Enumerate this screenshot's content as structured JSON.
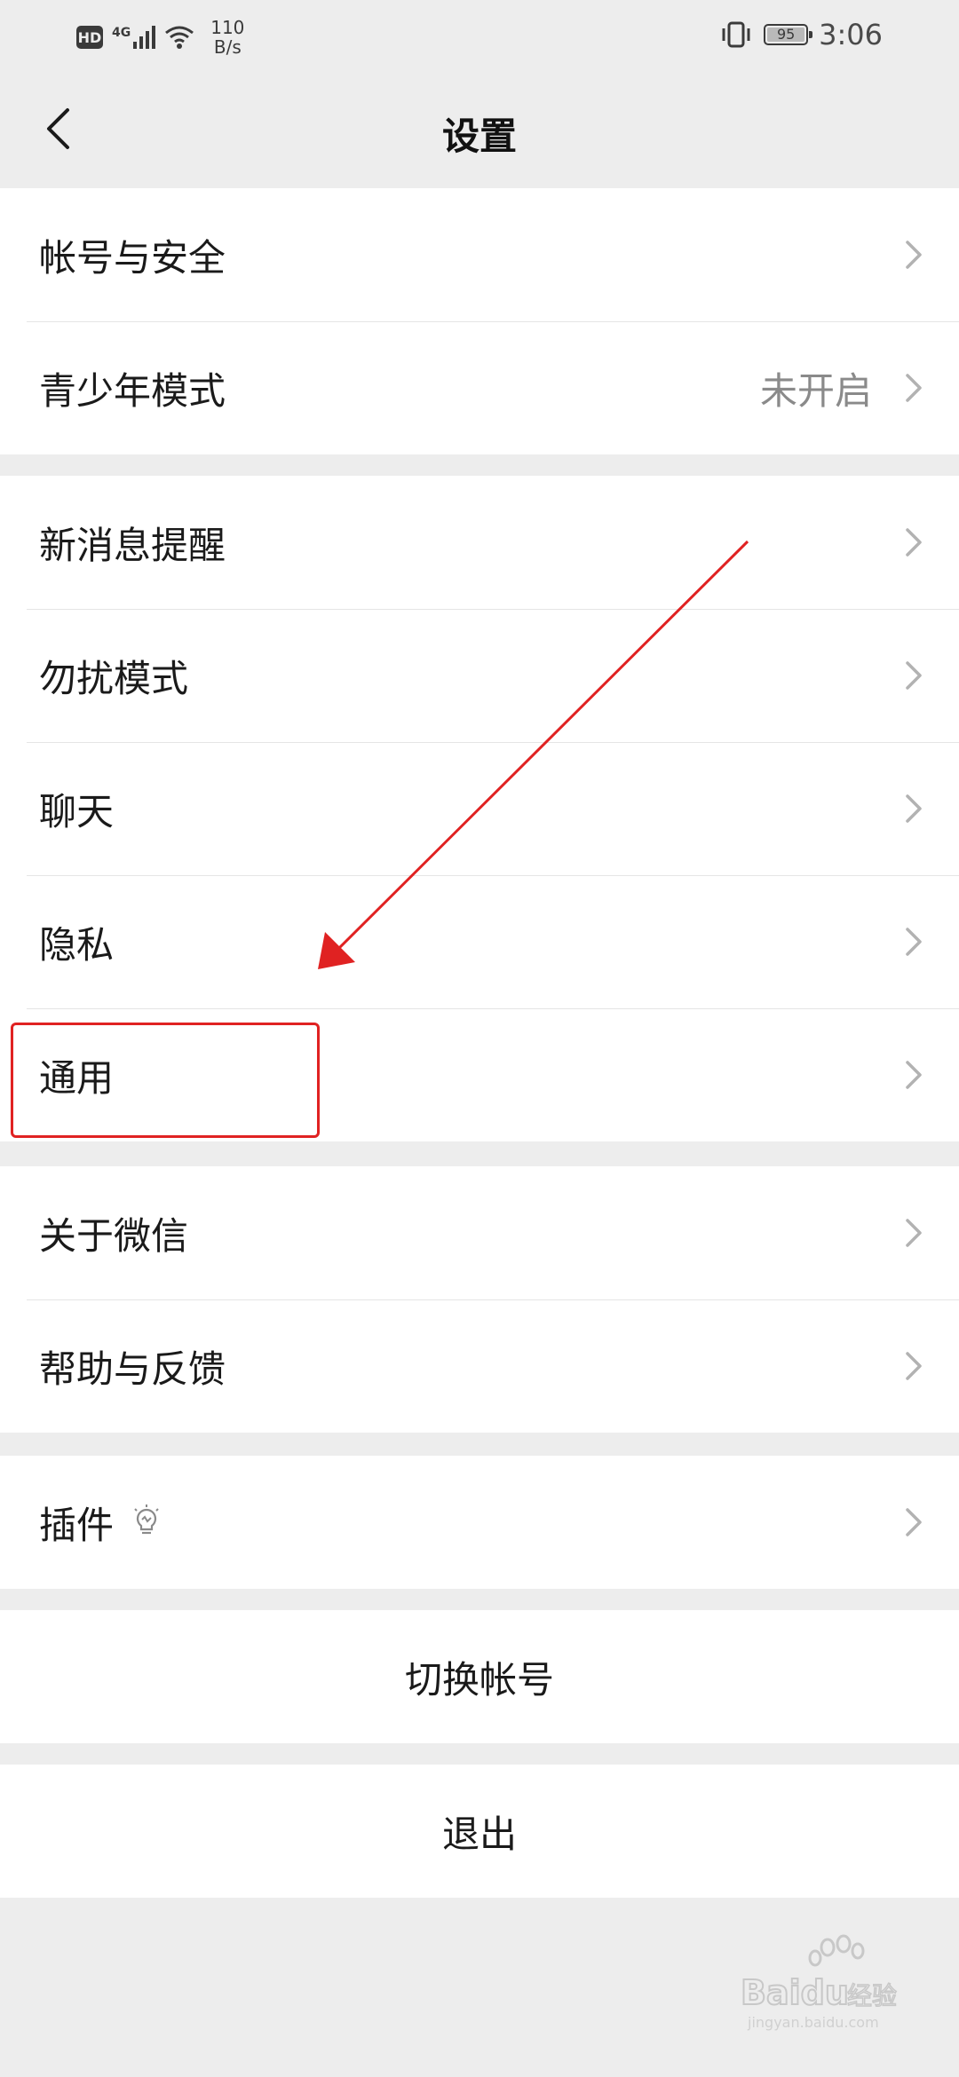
{
  "status_bar": {
    "hd": "HD",
    "network": "4G",
    "speed_value": "110",
    "speed_unit": "B/s",
    "battery": "95",
    "time": "3:06"
  },
  "nav": {
    "title": "设置"
  },
  "groups": {
    "g1": [
      {
        "label": "帐号与安全"
      },
      {
        "label": "青少年模式",
        "value": "未开启"
      }
    ],
    "g2": [
      {
        "label": "新消息提醒"
      },
      {
        "label": "勿扰模式"
      },
      {
        "label": "聊天"
      },
      {
        "label": "隐私"
      },
      {
        "label": "通用"
      }
    ],
    "g3": [
      {
        "label": "关于微信"
      },
      {
        "label": "帮助与反馈"
      }
    ],
    "g4": [
      {
        "label": "插件"
      }
    ]
  },
  "actions": {
    "switch_account": "切换帐号",
    "logout": "退出"
  },
  "watermark": {
    "brand": "Baidu",
    "cn": "经验",
    "url": "jingyan.baidu.com"
  },
  "colors": {
    "highlight": "#e02222",
    "background": "#ededed",
    "chevron": "#b2b2b2"
  }
}
